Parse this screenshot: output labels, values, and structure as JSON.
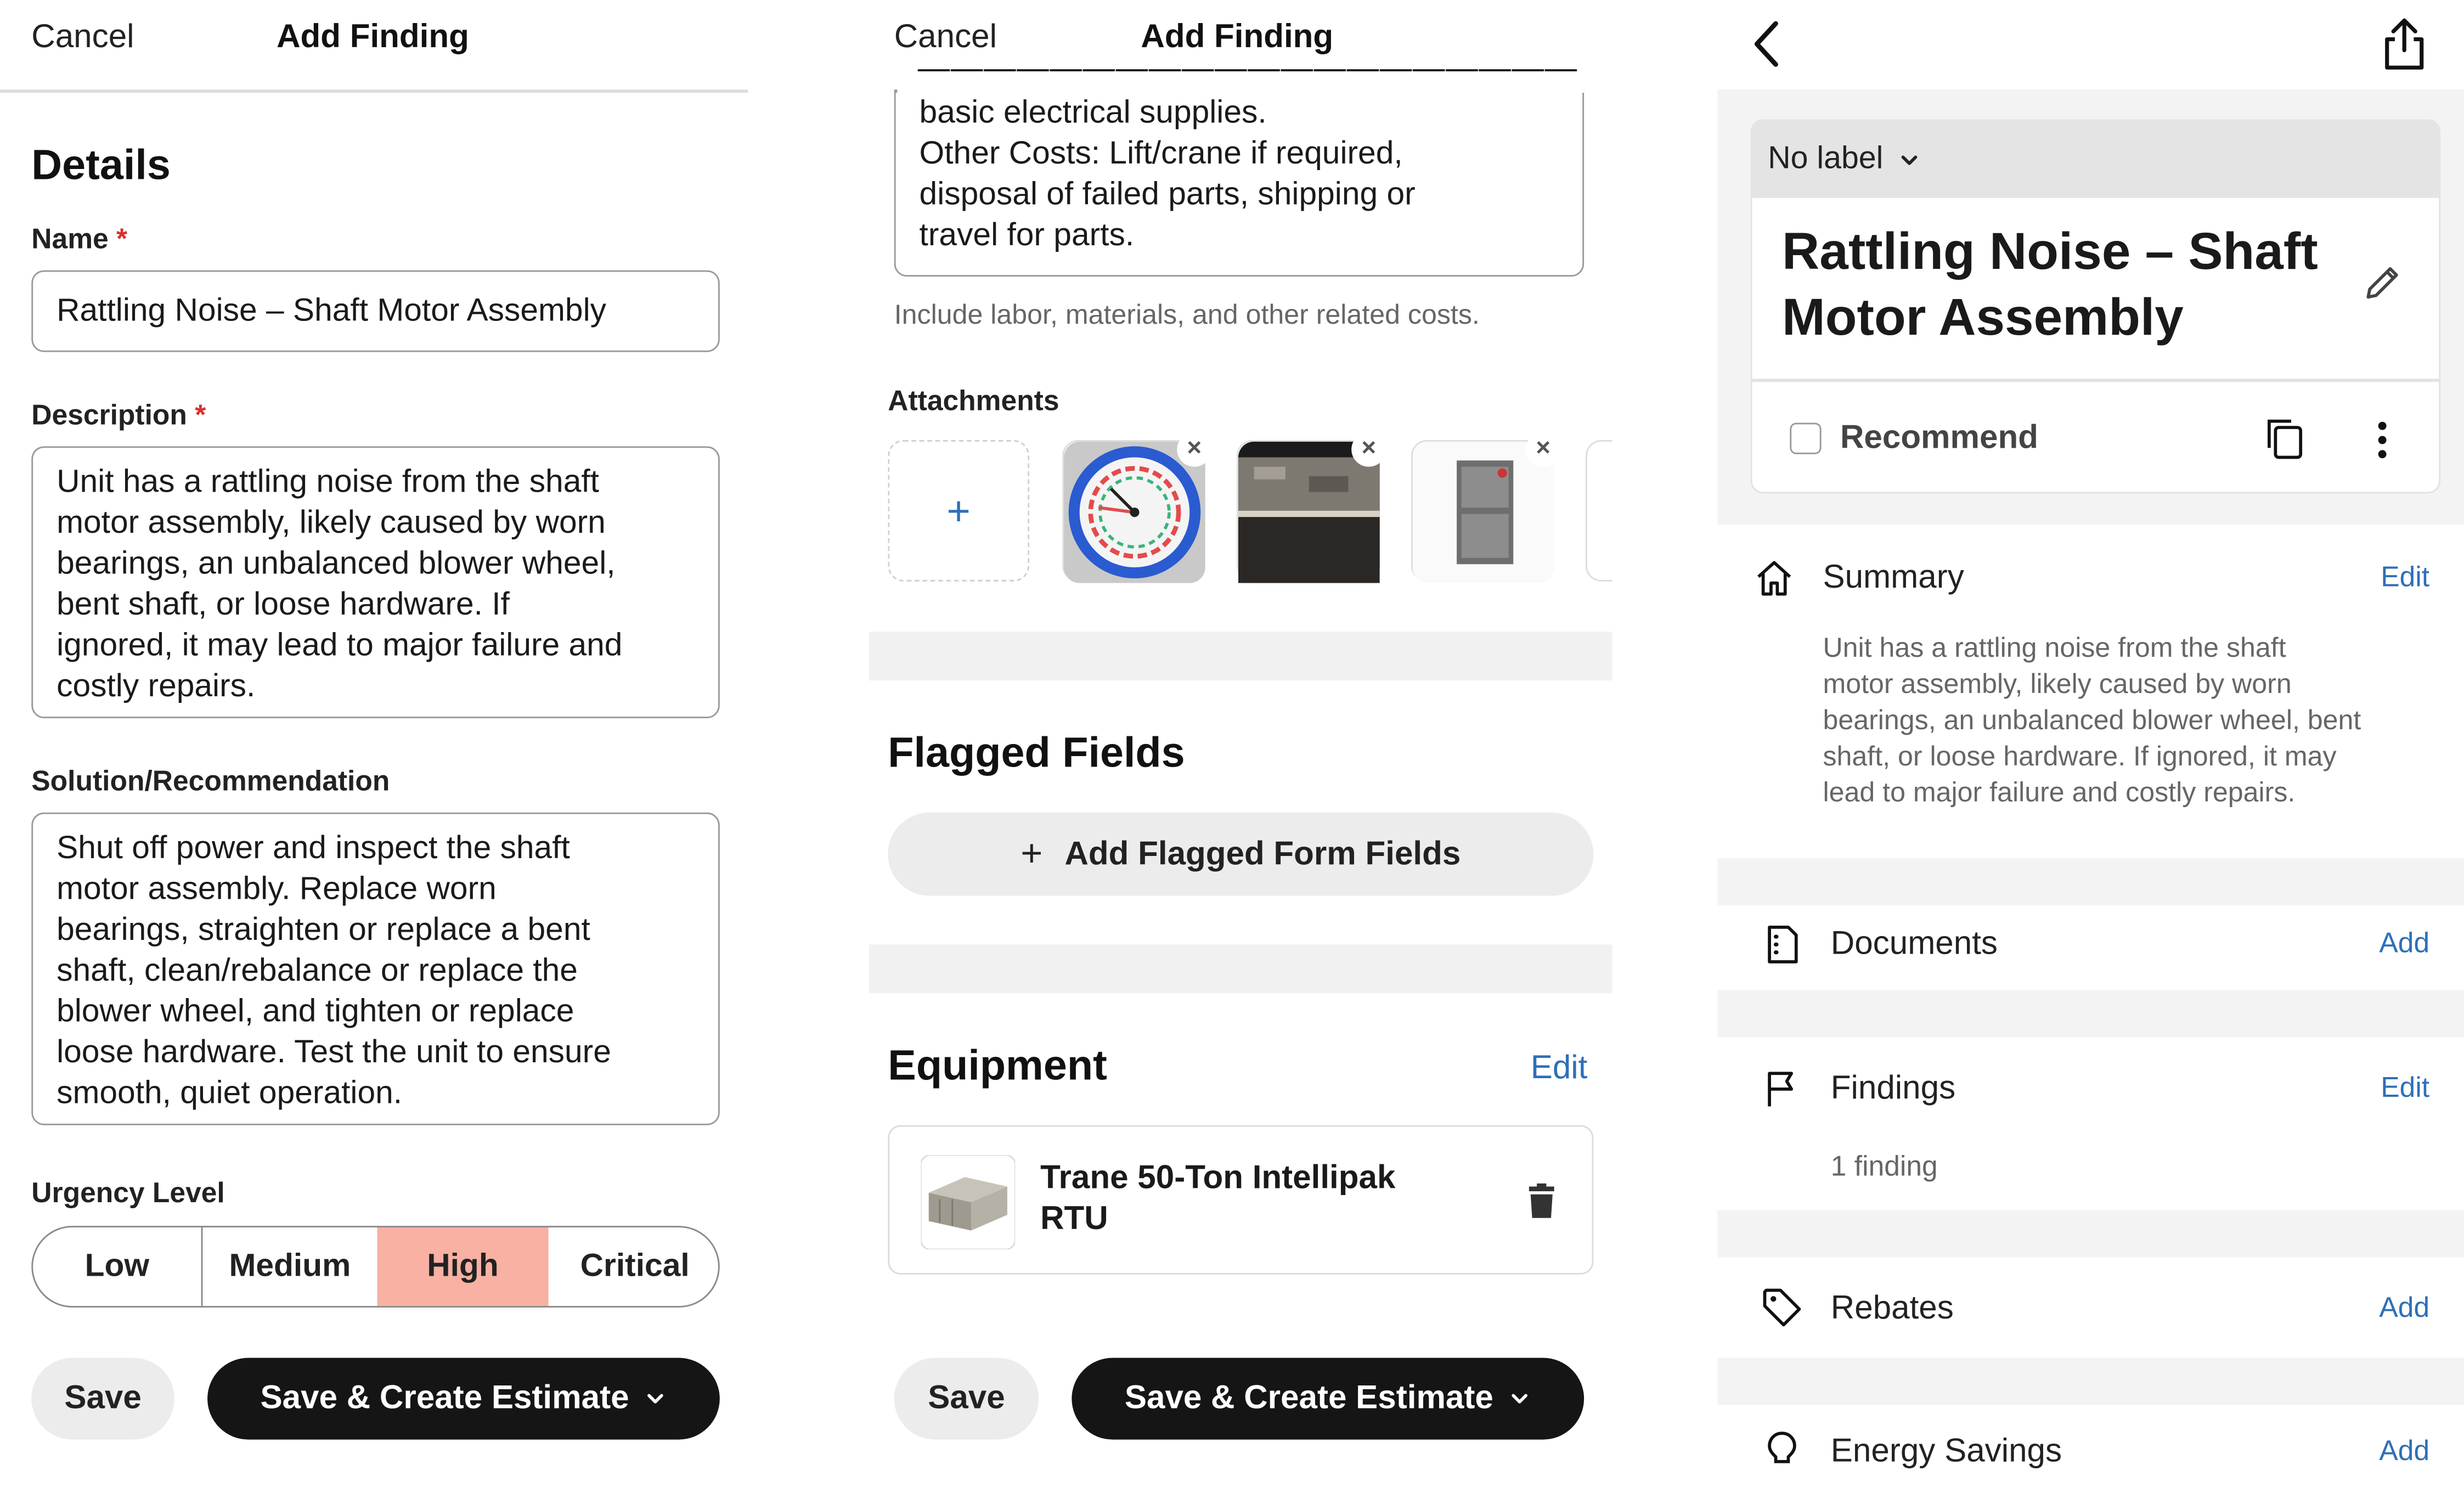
{
  "colors": {
    "urgency_selected": "#f8b1a3",
    "link": "#2f6fb8",
    "dark_button": "#151515"
  },
  "panel1": {
    "header": {
      "cancel": "Cancel",
      "title": "Add Finding"
    },
    "details_heading": "Details",
    "name": {
      "label": "Name",
      "required": "*",
      "value": "Rattling Noise – Shaft Motor Assembly"
    },
    "description": {
      "label": "Description",
      "required": "*",
      "value": "Unit has a rattling noise from the shaft\nmotor assembly, likely caused by worn\nbearings, an unbalanced blower wheel,\nbent shaft, or loose hardware. If\nignored, it may lead to major failure and\ncostly repairs."
    },
    "solution": {
      "label": "Solution/Recommendation",
      "value": "Shut off power and inspect the shaft\nmotor assembly. Replace worn\nbearings, straighten or replace a bent\nshaft, clean/rebalance or replace the\nblower wheel, and tighten or replace\nloose hardware. Test the unit to ensure\nsmooth, quiet operation."
    },
    "urgency": {
      "label": "Urgency Level",
      "options": [
        "Low",
        "Medium",
        "High",
        "Critical"
      ],
      "selected": "High"
    },
    "buttons": {
      "save": "Save",
      "save_create": "Save & Create Estimate"
    }
  },
  "panel2": {
    "header": {
      "cancel": "Cancel",
      "title": "Add Finding"
    },
    "costs_text": "basic electrical supplies.\nOther Costs: Lift/crane if required,\ndisposal of failed parts, shipping or\ntravel for parts.",
    "costs_hint": "Include labor, materials, and other related costs.",
    "attachments": {
      "label": "Attachments",
      "add_symbol": "+",
      "remove_symbol": "×"
    },
    "flagged": {
      "heading": "Flagged Fields",
      "button_icon": "+",
      "button": "Add Flagged Form Fields"
    },
    "equipment": {
      "heading": "Equipment",
      "edit": "Edit",
      "item_name": "Trane 50-Ton Intellipak\nRTU"
    },
    "buttons": {
      "save": "Save",
      "save_create": "Save & Create Estimate"
    }
  },
  "panel3": {
    "label_select": "No label",
    "title": "Rattling Noise – Shaft\nMotor Assembly",
    "recommend": "Recommend",
    "summary": {
      "label": "Summary",
      "action": "Edit",
      "text": "Unit has a rattling noise from the shaft\nmotor assembly, likely caused by worn\nbearings, an unbalanced blower wheel, bent\nshaft, or loose hardware. If ignored, it may\nlead to major failure and costly repairs."
    },
    "documents": {
      "label": "Documents",
      "action": "Add"
    },
    "findings": {
      "label": "Findings",
      "action": "Edit",
      "count": "1 finding"
    },
    "rebates": {
      "label": "Rebates",
      "action": "Add"
    },
    "energy": {
      "label": "Energy Savings",
      "action": "Add"
    }
  }
}
